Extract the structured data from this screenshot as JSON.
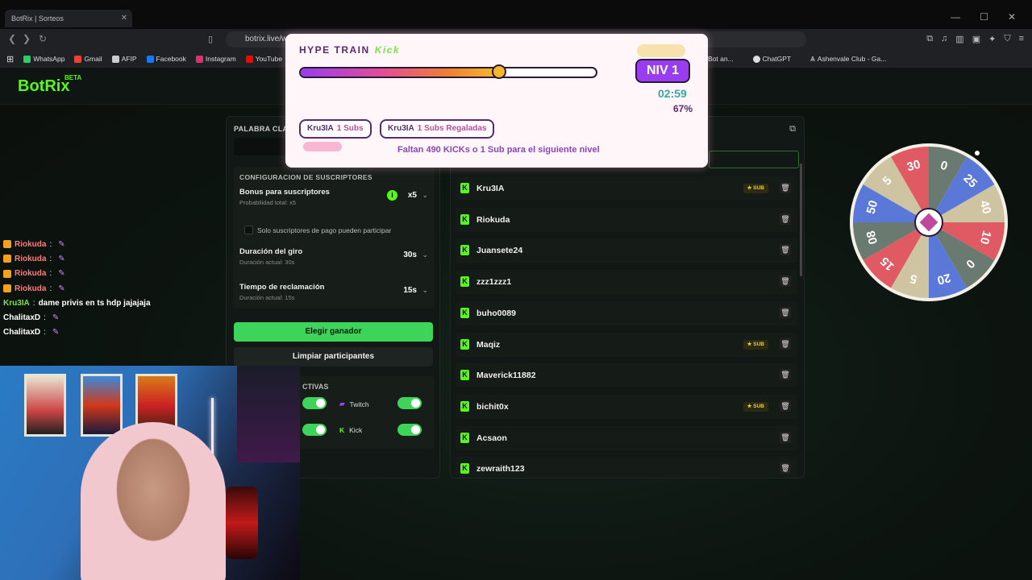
{
  "browser": {
    "tab_title": "BotRix | Sorteos",
    "url": "botrix.live/w",
    "bookmarks": [
      {
        "label": "WhatsApp",
        "color": "#25d366"
      },
      {
        "label": "Gmail",
        "color": "#ea4335"
      },
      {
        "label": "AFIP",
        "color": "#cccccc"
      },
      {
        "label": "Facebook",
        "color": "#1877f2"
      },
      {
        "label": "Instagram",
        "color": "#e1306c"
      },
      {
        "label": "YouTube",
        "color": "#ff0000"
      }
    ],
    "bookmarks_right": [
      {
        "label": "Bot an..."
      },
      {
        "label": "ChatGPT"
      },
      {
        "label": "Ashenvale Club - Ga..."
      }
    ]
  },
  "app": {
    "logo": "BotRix",
    "logo_badge": "BETA",
    "palabra_label": "PALABRA CLA",
    "subs_config": {
      "title": "CONFIGURACION DE SUSCRIPTORES",
      "bonus_title": "Bonus para suscriptores",
      "bonus_sub": "Probabilidad total: x5",
      "bonus_value": "x5",
      "only_paid": "Solo suscriptores de pago pueden participar",
      "duration_title": "Duración del giro",
      "duration_sub": "Duración actual: 30s",
      "duration_value": "30s",
      "claim_title": "Tiempo de reclamación",
      "claim_sub": "Duración actual: 15s",
      "claim_value": "15s"
    },
    "btn_ganador": "Elegir ganador",
    "btn_limpiar": "Limpiar participantes",
    "platforms_title": "CTIVAS",
    "platform_twitch": "Twitch",
    "platform_kick": "Kick",
    "participants": [
      {
        "name": "Kru3IA",
        "sub": true
      },
      {
        "name": "Riokuda",
        "sub": false
      },
      {
        "name": "Juansete24",
        "sub": false
      },
      {
        "name": "zzz1zzz1",
        "sub": false
      },
      {
        "name": "buho0089",
        "sub": false
      },
      {
        "name": "Maqiz",
        "sub": true
      },
      {
        "name": "Maverick11882",
        "sub": false
      },
      {
        "name": "bichit0x",
        "sub": true
      },
      {
        "name": "Acsaon",
        "sub": false
      },
      {
        "name": "zewraith123",
        "sub": false
      }
    ],
    "sub_badge": "SUB"
  },
  "chat": [
    {
      "user": "Riokuda",
      "text": "",
      "color": "#ff7a7a",
      "badge": true
    },
    {
      "user": "Riokuda",
      "text": "",
      "color": "#ff7a7a",
      "badge": true
    },
    {
      "user": "Riokuda",
      "text": "",
      "color": "#ff7a7a",
      "badge": true
    },
    {
      "user": "Riokuda",
      "text": "",
      "color": "#ff7a7a",
      "badge": true
    },
    {
      "user": "Kru3IA",
      "text": "dame privis en ts hdp jajajaja",
      "color": "#7ee04a",
      "badge": false
    },
    {
      "user": "ChalitaxD",
      "text": "",
      "color": "#ffffff",
      "badge": false
    },
    {
      "user": "ChalitaxD",
      "text": "",
      "color": "#ffffff",
      "badge": false
    }
  ],
  "hype_train": {
    "title": "HYPE TRAIN",
    "platform": "Kick",
    "progress": 0.67,
    "level": "NIV 1",
    "timer": "02:59",
    "percent": "67%",
    "chip1_user": "Kru3IA",
    "chip1_value": "1 Subs",
    "chip2_user": "Kru3IA",
    "chip2_value": "1 Subs Regaladas",
    "message": "Faltan 490 KICKs o 1 Sub para el siguiente nivel"
  },
  "wheel": {
    "segments": [
      {
        "label": "0",
        "color": "#6a7a70"
      },
      {
        "label": "25",
        "color": "#5a78d8"
      },
      {
        "label": "40",
        "color": "#cfc4a2"
      },
      {
        "label": "10",
        "color": "#e05a64"
      },
      {
        "label": "0",
        "color": "#6a7a70"
      },
      {
        "label": "20",
        "color": "#5a78d8"
      },
      {
        "label": "5",
        "color": "#cfc4a2"
      },
      {
        "label": "15",
        "color": "#e05a64"
      },
      {
        "label": "08",
        "color": "#6a7a70"
      },
      {
        "label": "50",
        "color": "#5a78d8"
      },
      {
        "label": "5",
        "color": "#cfc4a2"
      },
      {
        "label": "30",
        "color": "#e05a64"
      }
    ]
  }
}
